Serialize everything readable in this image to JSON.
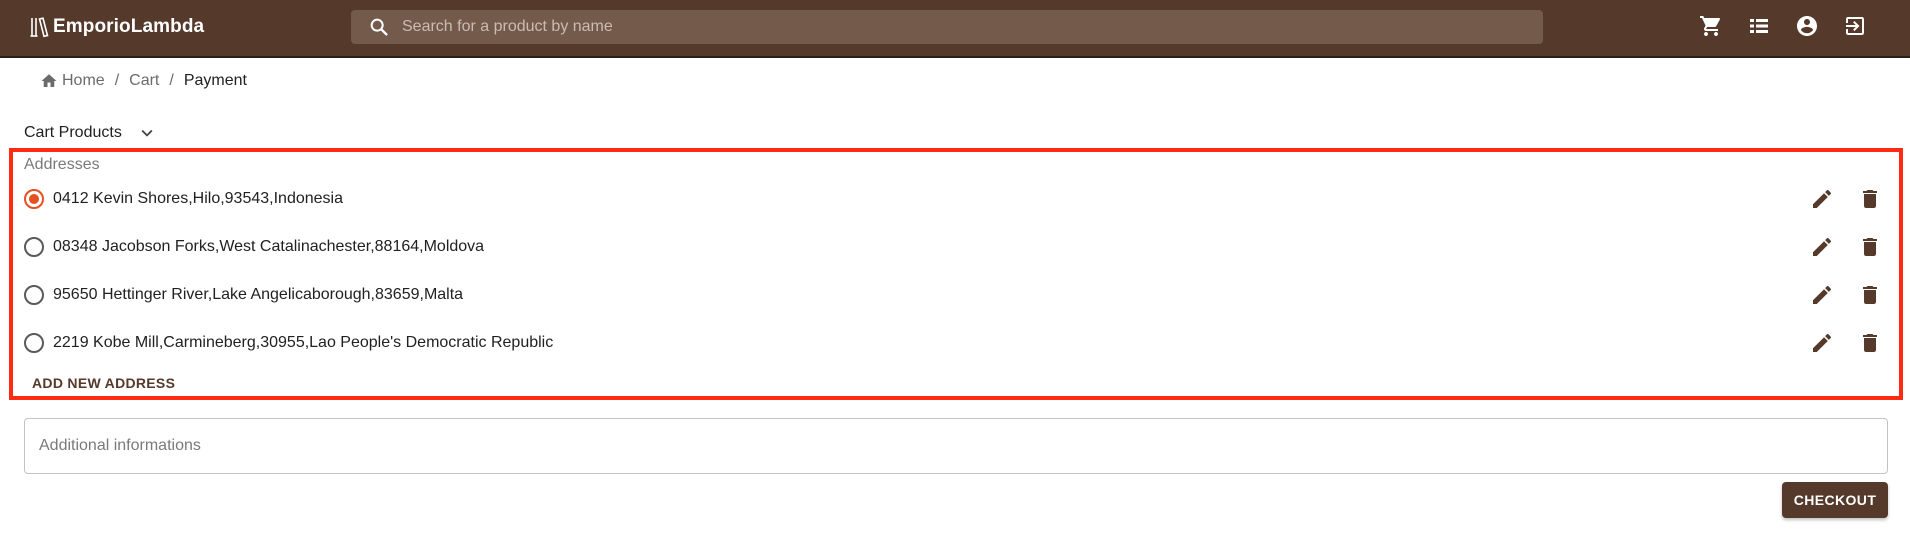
{
  "app": {
    "brand": "EmporioLambda",
    "search_placeholder": "Search for a product by name"
  },
  "appbar_icons": [
    "cart-icon",
    "orders-list-icon",
    "account-icon",
    "logout-icon"
  ],
  "breadcrumb": {
    "home": "Home",
    "separator": "/",
    "cart": "Cart",
    "current": "Payment"
  },
  "cart_products": {
    "label": "Cart Products"
  },
  "addresses": {
    "label": "Addresses",
    "items": [
      {
        "text": "0412 Kevin Shores,Hilo,93543,Indonesia",
        "selected": true
      },
      {
        "text": "08348 Jacobson Forks,West Catalinachester,88164,Moldova",
        "selected": false
      },
      {
        "text": "95650 Hettinger River,Lake Angelicaborough,83659,Malta",
        "selected": false
      },
      {
        "text": "2219 Kobe Mill,Carmineberg,30955,Lao People's Democratic Republic",
        "selected": false
      }
    ],
    "add_label": "ADD NEW ADDRESS"
  },
  "additional_info": {
    "placeholder": "Additional informations"
  },
  "checkout": {
    "label": "CHECKOUT"
  },
  "colors": {
    "primary": "#55392a",
    "accent": "#e4501f",
    "highlight": "#ff2a12"
  }
}
